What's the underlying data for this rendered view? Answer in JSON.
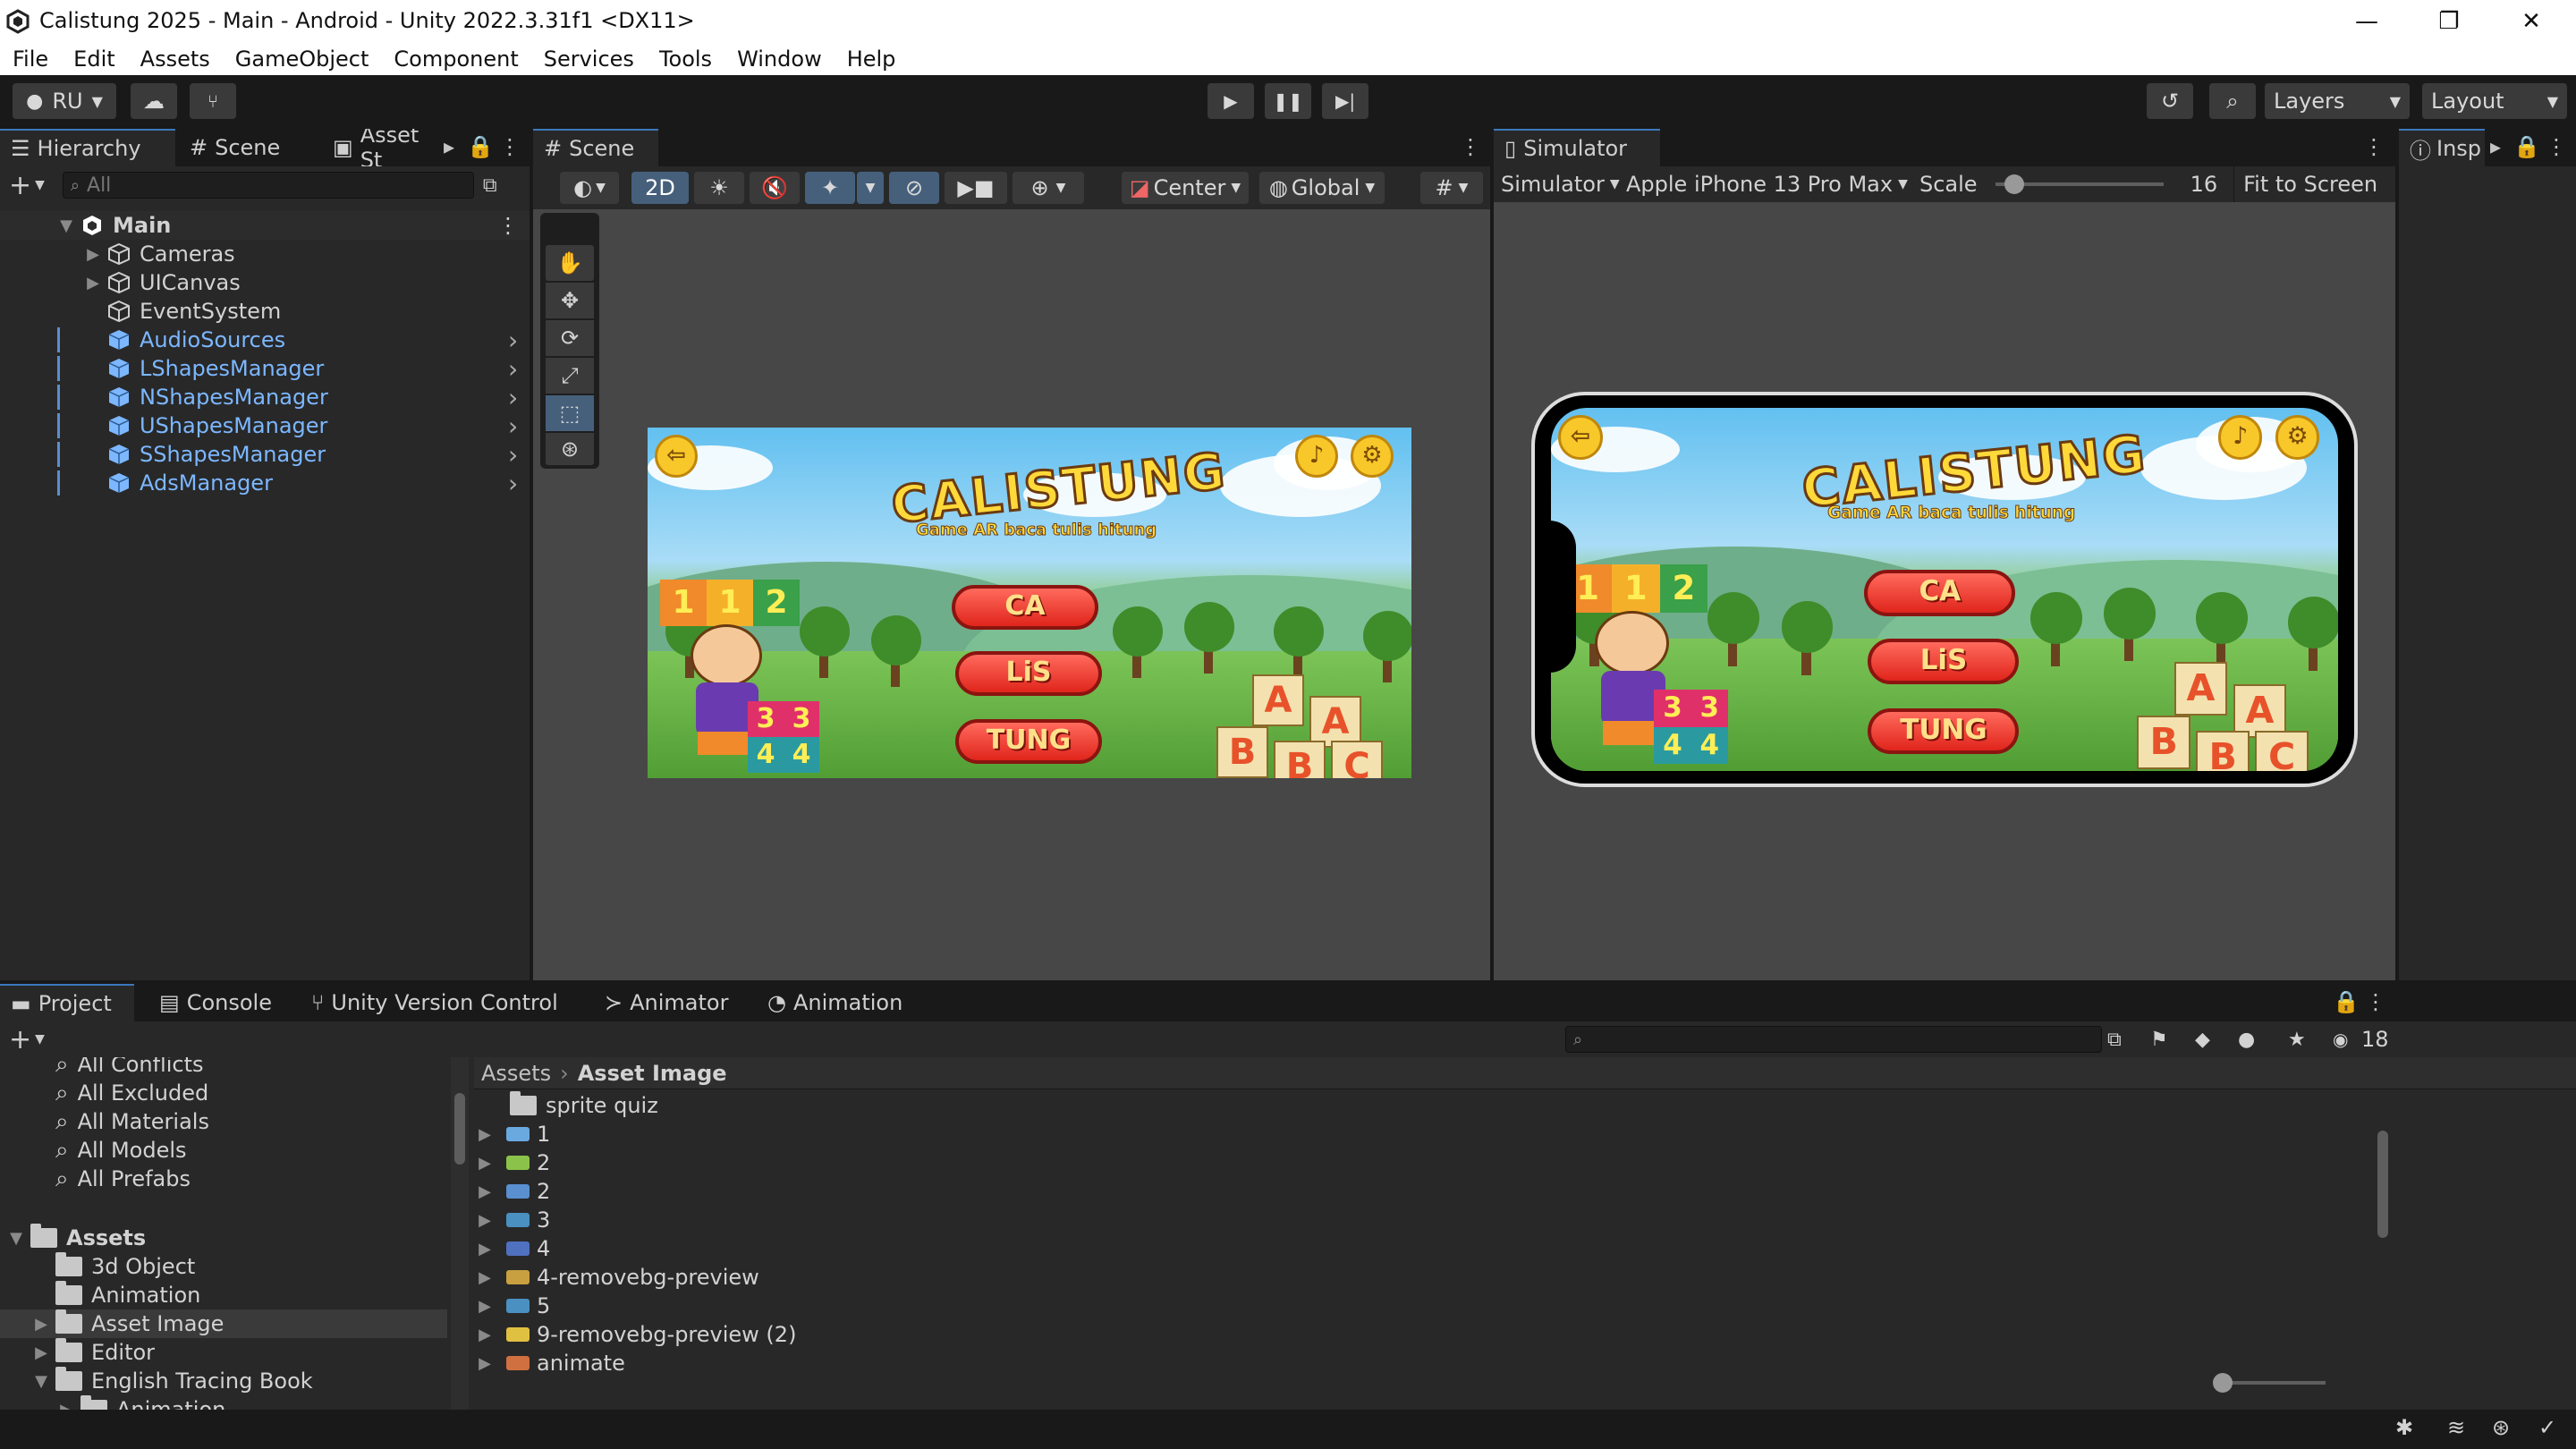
{
  "window": {
    "title": "Calistung 2025 - Main - Android - Unity 2022.3.31f1 <DX11>",
    "minimize": "—",
    "maximize": "❐",
    "close": "✕"
  },
  "menu": [
    "File",
    "Edit",
    "Assets",
    "GameObject",
    "Component",
    "Services",
    "Tools",
    "Window",
    "Help"
  ],
  "toolbar": {
    "account": "RU",
    "layers": "Layers",
    "layout": "Layout"
  },
  "hierarchy": {
    "tabs": [
      "Hierarchy",
      "Scene",
      "Asset St"
    ],
    "search_placeholder": "All",
    "scene_root": "Main",
    "items": [
      {
        "label": "Cameras",
        "expandable": true,
        "prefab": false
      },
      {
        "label": "UICanvas",
        "expandable": true,
        "prefab": false
      },
      {
        "label": "EventSystem",
        "expandable": false,
        "prefab": false
      },
      {
        "label": "AudioSources",
        "expandable": false,
        "prefab": true
      },
      {
        "label": "LShapesManager",
        "expandable": false,
        "prefab": true
      },
      {
        "label": "NShapesManager",
        "expandable": false,
        "prefab": true
      },
      {
        "label": "UShapesManager",
        "expandable": false,
        "prefab": true
      },
      {
        "label": "SShapesManager",
        "expandable": false,
        "prefab": true
      },
      {
        "label": "AdsManager",
        "expandable": false,
        "prefab": true
      }
    ]
  },
  "scene": {
    "tab": "Scene",
    "mode_2d": "2D",
    "pivot": "Center",
    "space": "Global"
  },
  "simulator": {
    "tab": "Simulator",
    "mode": "Simulator",
    "device": "Apple iPhone 13 Pro Max",
    "scale_label": "Scale",
    "scale_value": "16",
    "fit": "Fit to Screen"
  },
  "inspector": {
    "tab": "Insp"
  },
  "game": {
    "logo": "CALISTUNG",
    "subtitle": "Game AR baca tulis hitung",
    "buttons": [
      "CA",
      "LiS",
      "TUNG"
    ],
    "blocks_top": [
      "1",
      "1",
      "2"
    ],
    "blocks_bottom": [
      "3",
      "3",
      "4",
      "4"
    ],
    "letter_blocks": [
      "A",
      "A",
      "B",
      "B",
      "C"
    ]
  },
  "bottom": {
    "tabs": [
      "Project",
      "Console",
      "Unity Version Control",
      "Animator",
      "Animation"
    ],
    "count": "18",
    "breadcrumb_root": "Assets",
    "breadcrumb_current": "Asset Image",
    "favorites": [
      "All Conflicts",
      "All Excluded",
      "All Materials",
      "All Models",
      "All Prefabs"
    ],
    "assets_root": "Assets",
    "folders": [
      {
        "label": "3d Object",
        "indent": 1,
        "arrow": ""
      },
      {
        "label": "Animation",
        "indent": 1,
        "arrow": ""
      },
      {
        "label": "Asset Image",
        "indent": 1,
        "arrow": "▶"
      },
      {
        "label": "Editor",
        "indent": 1,
        "arrow": "▶"
      },
      {
        "label": "English Tracing Book",
        "indent": 1,
        "arrow": "▼"
      },
      {
        "label": "Animation",
        "indent": 2,
        "arrow": "▶"
      }
    ],
    "files": [
      {
        "label": "sprite quiz",
        "kind": "folder"
      },
      {
        "label": "1",
        "kind": "sprite"
      },
      {
        "label": "2",
        "kind": "sprite"
      },
      {
        "label": "2",
        "kind": "sprite"
      },
      {
        "label": "3",
        "kind": "sprite"
      },
      {
        "label": "4",
        "kind": "sprite"
      },
      {
        "label": "4-removebg-preview",
        "kind": "sprite"
      },
      {
        "label": "5",
        "kind": "sprite"
      },
      {
        "label": "9-removebg-preview (2)",
        "kind": "sprite"
      },
      {
        "label": "animate",
        "kind": "sprite"
      }
    ]
  }
}
